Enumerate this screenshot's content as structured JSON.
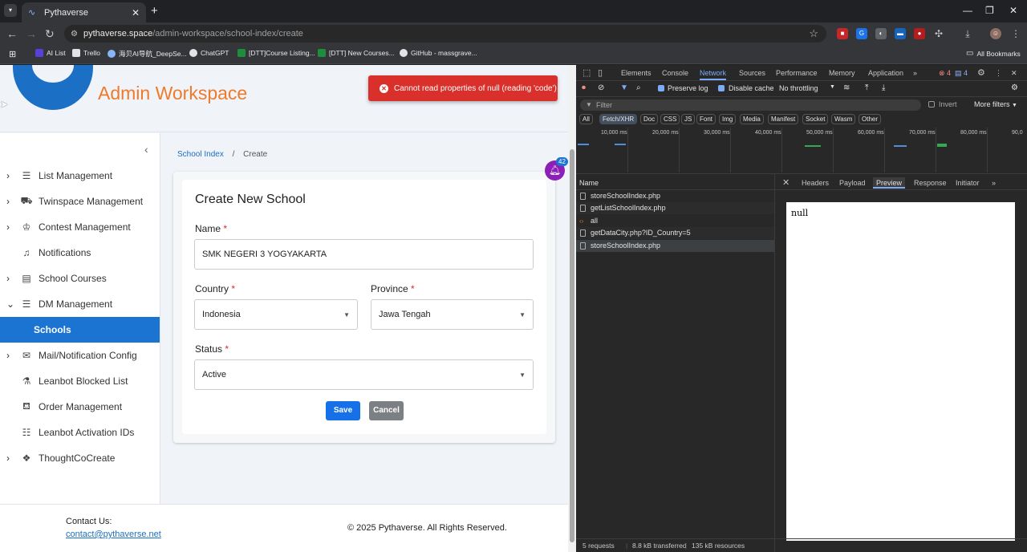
{
  "browser": {
    "tab_title": "Pythaverse",
    "url_host": "pythaverse.space",
    "url_path": "/admin-workspace/school-index/create",
    "bookmarks": [
      "AI List",
      "Trello",
      "海贝AI导航_DeepSe...",
      "ChatGPT",
      "[DTT]Course Listing...",
      "[DTT] New Courses...",
      "GitHub - massgrave..."
    ],
    "all_bookmarks": "All Bookmarks"
  },
  "app": {
    "name": "Admin Workspace",
    "toast": "Cannot read properties of null (reading 'code')",
    "notification_count": "42"
  },
  "sidebar": {
    "items": [
      {
        "label": "List Management",
        "icon": "list-icon",
        "expandable": true
      },
      {
        "label": "Twinspace Management",
        "icon": "car-icon",
        "expandable": true
      },
      {
        "label": "Contest Management",
        "icon": "trophy-icon",
        "expandable": true
      },
      {
        "label": "Notifications",
        "icon": "bell-icon",
        "expandable": false
      },
      {
        "label": "School Courses",
        "icon": "book-icon",
        "expandable": true
      },
      {
        "label": "DM Management",
        "icon": "list-icon",
        "expandable": true,
        "expanded": true
      },
      {
        "label": "Schools",
        "icon": "",
        "active": true
      },
      {
        "label": "Mail/Notification Config",
        "icon": "mail-icon",
        "expandable": true
      },
      {
        "label": "Leanbot Blocked List",
        "icon": "flask-icon",
        "expandable": false
      },
      {
        "label": "Order Management",
        "icon": "basket-icon",
        "expandable": false
      },
      {
        "label": "Leanbot Activation IDs",
        "icon": "checklist-icon",
        "expandable": false
      },
      {
        "label": "ThoughtCoCreate",
        "icon": "cubes-icon",
        "expandable": true
      }
    ]
  },
  "breadcrumb": {
    "parent": "School Index",
    "separator": "/",
    "current": "Create"
  },
  "form": {
    "title": "Create New School",
    "name_label": "Name",
    "name_value": "SMK NEGERI 3 YOGYAKARTA",
    "country_label": "Country",
    "country_value": "Indonesia",
    "province_label": "Province",
    "province_value": "Jawa Tengah",
    "status_label": "Status",
    "status_value": "Active",
    "required_mark": "*",
    "save_label": "Save",
    "cancel_label": "Cancel"
  },
  "footer": {
    "contact_label": "Contact Us:",
    "contact_email": "contact@pythaverse.net",
    "copyright": "© 2025 Pythaverse. All Rights Reserved."
  },
  "devtools": {
    "tabs": [
      "Elements",
      "Console",
      "Network",
      "Sources",
      "Performance",
      "Memory",
      "Application"
    ],
    "active_tab": "Network",
    "errors": "4",
    "messages": "4",
    "preserve_log": "Preserve log",
    "disable_cache": "Disable cache",
    "throttling": "No throttling",
    "filter_placeholder": "Filter",
    "invert": "Invert",
    "more_filters": "More filters",
    "type_chips": [
      "All",
      "Fetch/XHR",
      "Doc",
      "CSS",
      "JS",
      "Font",
      "Img",
      "Media",
      "Manifest",
      "Socket",
      "Wasm",
      "Other"
    ],
    "timeline_labels": [
      "10,000 ms",
      "20,000 ms",
      "30,000 ms",
      "40,000 ms",
      "50,000 ms",
      "60,000 ms",
      "70,000 ms",
      "80,000 ms",
      "90,0"
    ],
    "name_header": "Name",
    "requests": [
      "storeSchoolIndex.php",
      "getListSchoolIndex.php",
      "all",
      "getDataCity.php?ID_Country=5",
      "storeSchoolIndex.php"
    ],
    "panel_tabs": [
      "Headers",
      "Payload",
      "Preview",
      "Response",
      "Initiator"
    ],
    "active_panel_tab": "Preview",
    "preview_body": "null",
    "status_requests": "5 requests",
    "status_transferred": "8.8 kB transferred",
    "status_resources": "135 kB resources"
  },
  "colors": {
    "accent": "#1b74d1",
    "brand_orange": "#ee7a2b",
    "toast_red": "#d9302c",
    "bell_purple": "#8c1fb5"
  }
}
